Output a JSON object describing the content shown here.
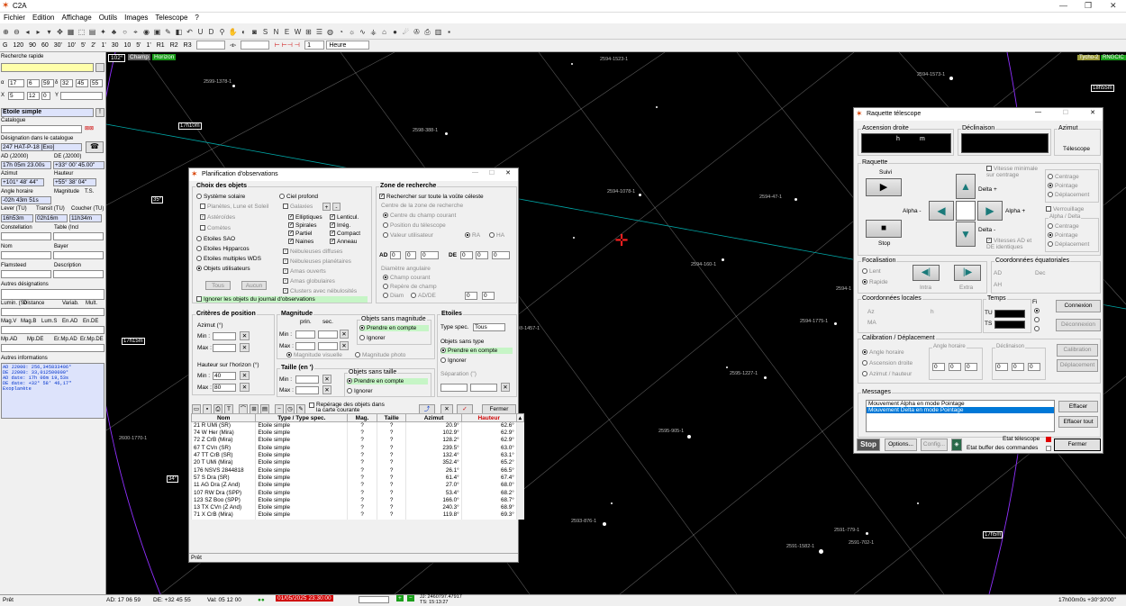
{
  "app": {
    "title": "C2A"
  },
  "menu": [
    "Fichier",
    "Edition",
    "Affichage",
    "Outils",
    "Images",
    "Telescope",
    "?"
  ],
  "toolbar2": [
    "G",
    "120",
    "90",
    "60",
    "30'",
    "10'",
    "5'",
    "2'",
    "1'",
    "30",
    "10",
    "5'",
    "1'",
    "R1",
    "R2",
    "R3",
    "1",
    "Heure"
  ],
  "left": {
    "quick_search": "Recherche rapide",
    "ra_h": "17",
    "ra_m": "6",
    "ra_s": "59",
    "dec_d": "32",
    "dec_m": "45",
    "dec_s": "55",
    "x": "5",
    "y_val": "12",
    "z": "0",
    "y": "Y",
    "type": "Etoile simple",
    "catalog": "Catalogue",
    "designation_label": "Désignation dans le catalogue",
    "designation": "247 HAT-P-18 [Exo]",
    "ad_label": "AD (J2000)",
    "de_label": "DE (J2000)",
    "ad": "17h 05m 23.00s",
    "de": "+33° 00' 45.00\"",
    "az_label": "Azimut",
    "h_label": "Hauteur",
    "az": "+101° 48' 44\"",
    "h": "+55° 38' 04\"",
    "ha_label": "Angle horaire",
    "mag_label": "Magnitude",
    "ts_label": "T.S.",
    "ha": "-02h 43m 51s",
    "lever_label": "Lever (TU)",
    "transit_label": "Transit (TU)",
    "coucher_label": "Coucher (TU)",
    "lever": "16h53m",
    "transit": "02h16m",
    "coucher": "11h34m",
    "constellation_label": "Constellation",
    "table_label": "Table (Incl",
    "nom_label": "Nom",
    "bayer_label": "Bayer",
    "flamsteed_label": "Flamsteed",
    "description_label": "Description",
    "autres_label": "Autres désignations",
    "lumin_label": "Lumin. (So",
    "distance_label": "Distance",
    "variab_label": "Variab.",
    "mult_label": "Mult.",
    "magv": "Mag.V",
    "magb": "Mag.B",
    "lums": "Lum.S",
    "enad": "En.AD",
    "ende": "En.DE",
    "mpad": "Mp.AD",
    "mpde": "Mp.DE",
    "ermpad": "Er.Mp.AD",
    "ermpde": "Er.Mp.DE",
    "autres_info_label": "Autres informations",
    "info": [
      "AD J2000: 256,345833406°",
      "DE J2000: 33,012500000°",
      "AD date: 17h 06m 19,53s",
      "DE date: +32° 58' 46,17\"",
      "Exoplanète"
    ]
  },
  "sky": {
    "fov": "102°",
    "champ": "Champ",
    "horizon": "Horizon",
    "tycho": "Tycho-2",
    "catalog_tag": "RNGCIC",
    "labels": [
      "2599-1378-1",
      "2598-388-1",
      "2594-1523-1",
      "2594-1573-1",
      "2594-1078-1",
      "2594-47-1",
      "2594-160-1",
      "2594-1775-1",
      "2595-1227-1",
      "2595-905-1",
      "2593-876-1",
      "2591-1582-1",
      "2591-779-1",
      "2591-702-1",
      "2600-1770-1",
      "2598-1457-1",
      "2594-1"
    ],
    "hours": [
      "17h10m",
      "18h55m",
      "17h15m",
      "17h5m",
      "17h00m"
    ],
    "decs": [
      "35°",
      "34°"
    ]
  },
  "planif": {
    "title": "Planification d'observations",
    "choix": "Choix des objets",
    "sys": "Système solaire",
    "ciel": "Ciel profond",
    "planetes": "Planètes, Lune et Soleil",
    "galaxies": "Galaxies",
    "asteroides": "Astéroïdes",
    "cometes": "Comètes",
    "elliptiques": "Elliptiques",
    "lenticul": "Lenticul.",
    "spirales": "Spirales",
    "irreg": "Irrég.",
    "partiel": "Partiel",
    "compact": "Compact",
    "naines": "Naines",
    "anneau": "Anneau",
    "etoiles_sao": "Etoiles SAO",
    "etoiles_hip": "Etoiles Hipparcos",
    "etoiles_wds": "Etoiles multiples WDS",
    "objets_util": "Objets utilisateurs",
    "nebuleuses": "Nébuleuses diffuses",
    "neb_plan": "Nébuleuses planétaires",
    "amas_ouv": "Amas ouverts",
    "amas_glob": "Amas globulaires",
    "clusters": "Clusters avec nébulosités",
    "tous": "Tous",
    "aucun": "Aucun",
    "ignorer": "Ignorer les objets du journal d'observations",
    "zone": "Zone de recherche",
    "rech_voute": "Rechercher sur toute la voûte céleste",
    "centre_zone": "Centre de la zone de recherche",
    "centre_champ": "Centre du champ courant",
    "pos_tel": "Position du télescope",
    "val_util": "Valeur utilisateur",
    "ra": "RA",
    "ha": "HA",
    "ad": "AD",
    "de": "DE",
    "diam": "Diamètre angulaire",
    "champ_cour": "Champ courant",
    "repere": "Repère de champ",
    "diam_lbl": "Diam",
    "adde": "AD/DE",
    "crit_pos": "Critères de position",
    "azimut": "Azimut (°)",
    "min": "Min :",
    "max": "Max :",
    "haut": "Hauteur sur l'horizon (°)",
    "hmin": "40",
    "hmax": "80",
    "magnitude": "Magnitude",
    "prin": "prin.",
    "sec": "sec.",
    "obj_sans_mag": "Objets sans magnitude",
    "prendre": "Prendre en compte",
    "ignorer2": "Ignorer",
    "mag_vis": "Magnitude visuelle",
    "mag_photo": "Magnitude photo",
    "taille": "Taille (en ')",
    "obj_sans_taille": "Objets sans taille",
    "etoiles": "Etoiles",
    "type_spec": "Type spec.",
    "tous2": "Tous",
    "obj_sans_type": "Objets sans type",
    "separation": "Séparation (\")",
    "reperage": "Repérage des objets dans la carte courante",
    "fermer": "Fermer",
    "cols": [
      "Nom",
      "Type / Type spec.",
      "Mag.",
      "Taille",
      "Azimut",
      "Hauteur"
    ],
    "rows": [
      [
        "21 R UMi (SR)",
        "Etoile simple",
        "?",
        "?",
        "20.9°",
        "62.6°"
      ],
      [
        "74 W Her (Mira)",
        "Etoile simple",
        "?",
        "?",
        "102.9°",
        "62.9°"
      ],
      [
        "72 Z CrB (Mira)",
        "Etoile simple",
        "?",
        "?",
        "128.2°",
        "62.9°"
      ],
      [
        "67 T CVn (SR)",
        "Etoile simple",
        "?",
        "?",
        "239.5°",
        "63.0°"
      ],
      [
        "47 TT CrB (SR)",
        "Etoile simple",
        "?",
        "?",
        "132.4°",
        "63.1°"
      ],
      [
        "20 T UMi (Mira)",
        "Etoile simple",
        "?",
        "?",
        "352.4°",
        "65.2°"
      ],
      [
        "176 NSVS 2844818",
        "Etoile simple",
        "?",
        "?",
        "26.1°",
        "66.5°"
      ],
      [
        "57 S Dra (SR)",
        "Etoile simple",
        "?",
        "?",
        "61.4°",
        "67.4°"
      ],
      [
        "11 AG Dra (Z And)",
        "Etoile simple",
        "?",
        "?",
        "27.0°",
        "68.0°"
      ],
      [
        "107 RW Dra (SPP)",
        "Etoile simple",
        "?",
        "?",
        "53.4°",
        "68.2°"
      ],
      [
        "123 SZ Boo (SPP)",
        "Etoile simple",
        "?",
        "?",
        "166.0°",
        "68.7°"
      ],
      [
        "13 TX CVn (Z And)",
        "Etoile simple",
        "?",
        "?",
        "240.3°",
        "68.9°"
      ],
      [
        "71 X CrB (Mira)",
        "Etoile simple",
        "?",
        "?",
        "119.8°",
        "69.3°"
      ]
    ],
    "status": "Prêt"
  },
  "raq": {
    "title": "Raquette télescope",
    "ad_label": "Ascension droite",
    "dec_label": "Déclinaison",
    "az_label": "Azimut",
    "h": "h",
    "m": "m",
    "telescope": "Télescope",
    "raquette": "Raquette",
    "suivi": "Suivi",
    "stop": "Stop",
    "alpha_m": "Alpha -",
    "alpha_p": "Alpha +",
    "delta_p": "Delta +",
    "delta_m": "Delta -",
    "vit_min": "Vitesse minimale sur centrage",
    "vit_ad": "Vitesses AD et DE identiques",
    "centrage": "Centrage",
    "pointage": "Pointage",
    "deplacement": "Déplacement",
    "verrou": "Verrouillage",
    "alpha_delta": "Alpha / Delta",
    "focal": "Focalisation",
    "lent": "Lent",
    "rapide": "Rapide",
    "intra": "Intra",
    "extra": "Extra",
    "coord_eq": "Coordonnées équatoriales",
    "ad": "AD",
    "dec": "Dec",
    "ah": "AH",
    "coord_loc": "Coordonnées locales",
    "az": "Az",
    "hh": "h",
    "ma": "MA",
    "temps": "Temps",
    "tu": "TU",
    "ts": "TS",
    "connexion": "Connexion",
    "deconnexion": "Déconnexion",
    "calib": "Calibration / Déplacement",
    "angle_h": "Angle horaire",
    "asc_dr": "Ascension droite",
    "az_haut": "Azimut / hauteur",
    "angle_h2": "Angle horaire",
    "decl": "Déclinaison",
    "calibration": "Calibration",
    "deplacement2": "Déplacement",
    "messages": "Messages",
    "msg1": "Mouvement Alpha en mode Pointage",
    "msg2": "Mouvement Delta en mode Pointage",
    "effacer": "Effacer",
    "effacer_tout": "Effacer tout",
    "etat_tel": "Etat télescope",
    "etat_buf": "Etat buffer des commandes",
    "stop_btn": "Stop",
    "options": "Options...",
    "config": "Config...",
    "fermer": "Fermer"
  },
  "status": {
    "pret": "Prêt",
    "ad": "AD: 17 06 59",
    "de": "DE: +32 45 55",
    "val": "Val: 05 12 00",
    "date": "01/05/2025 23:30:00",
    "jj": "JJ: 2460797.47917",
    "ts": "TS: 15:13:27",
    "right": "17h00m0s  +30°30'00\""
  },
  "colors": {
    "sky": "#000000",
    "accent": "#0033cc",
    "green": "#c6f5c6"
  }
}
